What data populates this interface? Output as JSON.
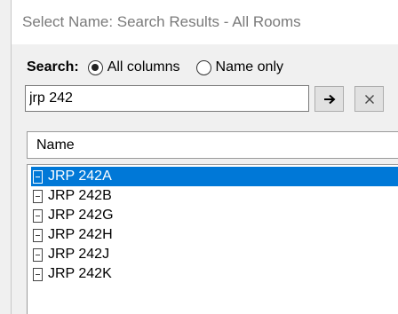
{
  "window": {
    "title": "Select Name: Search Results - All Rooms"
  },
  "search": {
    "label": "Search:",
    "options": [
      {
        "label": "All columns",
        "selected": true
      },
      {
        "label": "Name only",
        "selected": false
      }
    ],
    "value": "jrp 242",
    "go_icon": "arrow-right-icon",
    "clear_icon": "close-icon"
  },
  "results": {
    "column_header": "Name",
    "items": [
      {
        "label": "JRP 242A",
        "selected": true,
        "icon": "document-icon"
      },
      {
        "label": "JRP 242B",
        "selected": false,
        "icon": "document-icon"
      },
      {
        "label": "JRP 242G",
        "selected": false,
        "icon": "document-icon"
      },
      {
        "label": "JRP 242H",
        "selected": false,
        "icon": "document-icon"
      },
      {
        "label": "JRP 242J",
        "selected": false,
        "icon": "document-icon"
      },
      {
        "label": "JRP 242K",
        "selected": false,
        "icon": "document-icon"
      }
    ]
  },
  "colors": {
    "selection": "#0078d7",
    "title_text": "#7a7a7a"
  }
}
